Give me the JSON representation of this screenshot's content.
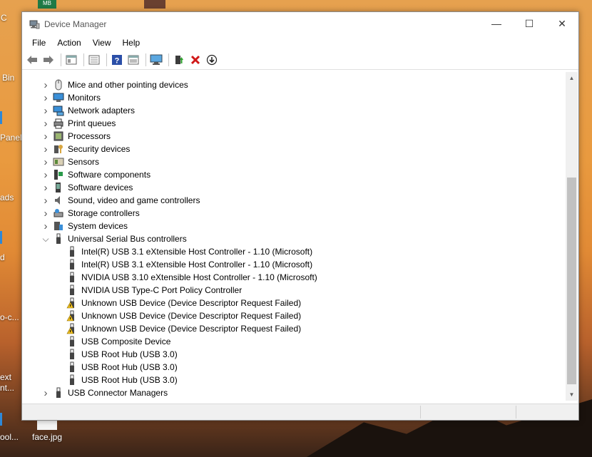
{
  "desktop": {
    "labels": [
      "C",
      "Bin",
      "Panel",
      "ads",
      "d",
      "o-c...",
      "ext",
      "nt...",
      "ool...",
      "face.jpg",
      "MB"
    ]
  },
  "window": {
    "title": "Device Manager",
    "controls": {
      "minimize": "—",
      "maximize": "☐",
      "close": "✕"
    }
  },
  "menu": [
    "File",
    "Action",
    "View",
    "Help"
  ],
  "toolbar": [
    "back-icon",
    "forward-icon",
    "properties-pane-icon",
    "list-icon",
    "help-icon",
    "view-icon",
    "monitor-icon",
    "update-driver-icon",
    "uninstall-icon",
    "download-icon"
  ],
  "tree": [
    {
      "label": "Mice and other pointing devices",
      "level": 0,
      "expanded": false,
      "icon": "mouse"
    },
    {
      "label": "Monitors",
      "level": 0,
      "expanded": false,
      "icon": "monitor"
    },
    {
      "label": "Network adapters",
      "level": 0,
      "expanded": false,
      "icon": "network"
    },
    {
      "label": "Print queues",
      "level": 0,
      "expanded": false,
      "icon": "printer"
    },
    {
      "label": "Processors",
      "level": 0,
      "expanded": false,
      "icon": "processor"
    },
    {
      "label": "Security devices",
      "level": 0,
      "expanded": false,
      "icon": "security"
    },
    {
      "label": "Sensors",
      "level": 0,
      "expanded": false,
      "icon": "sensor"
    },
    {
      "label": "Software components",
      "level": 0,
      "expanded": false,
      "icon": "software-component"
    },
    {
      "label": "Software devices",
      "level": 0,
      "expanded": false,
      "icon": "software-device"
    },
    {
      "label": "Sound, video and game controllers",
      "level": 0,
      "expanded": false,
      "icon": "speaker"
    },
    {
      "label": "Storage controllers",
      "level": 0,
      "expanded": false,
      "icon": "storage"
    },
    {
      "label": "System devices",
      "level": 0,
      "expanded": false,
      "icon": "system"
    },
    {
      "label": "Universal Serial Bus controllers",
      "level": 0,
      "expanded": true,
      "icon": "usb"
    },
    {
      "label": "Intel(R) USB 3.1 eXtensible Host Controller - 1.10 (Microsoft)",
      "level": 1,
      "icon": "usb"
    },
    {
      "label": "Intel(R) USB 3.1 eXtensible Host Controller - 1.10 (Microsoft)",
      "level": 1,
      "icon": "usb"
    },
    {
      "label": "NVIDIA USB 3.10 eXtensible Host Controller - 1.10 (Microsoft)",
      "level": 1,
      "icon": "usb"
    },
    {
      "label": "NVIDIA USB Type-C Port Policy Controller",
      "level": 1,
      "icon": "usb"
    },
    {
      "label": "Unknown USB Device (Device Descriptor Request Failed)",
      "level": 1,
      "icon": "usb-warning"
    },
    {
      "label": "Unknown USB Device (Device Descriptor Request Failed)",
      "level": 1,
      "icon": "usb-warning"
    },
    {
      "label": "Unknown USB Device (Device Descriptor Request Failed)",
      "level": 1,
      "icon": "usb-warning"
    },
    {
      "label": "USB Composite Device",
      "level": 1,
      "icon": "usb"
    },
    {
      "label": "USB Root Hub (USB 3.0)",
      "level": 1,
      "icon": "usb"
    },
    {
      "label": "USB Root Hub (USB 3.0)",
      "level": 1,
      "icon": "usb"
    },
    {
      "label": "USB Root Hub (USB 3.0)",
      "level": 1,
      "icon": "usb"
    },
    {
      "label": "USB Connector Managers",
      "level": 0,
      "expanded": false,
      "icon": "usb"
    }
  ]
}
